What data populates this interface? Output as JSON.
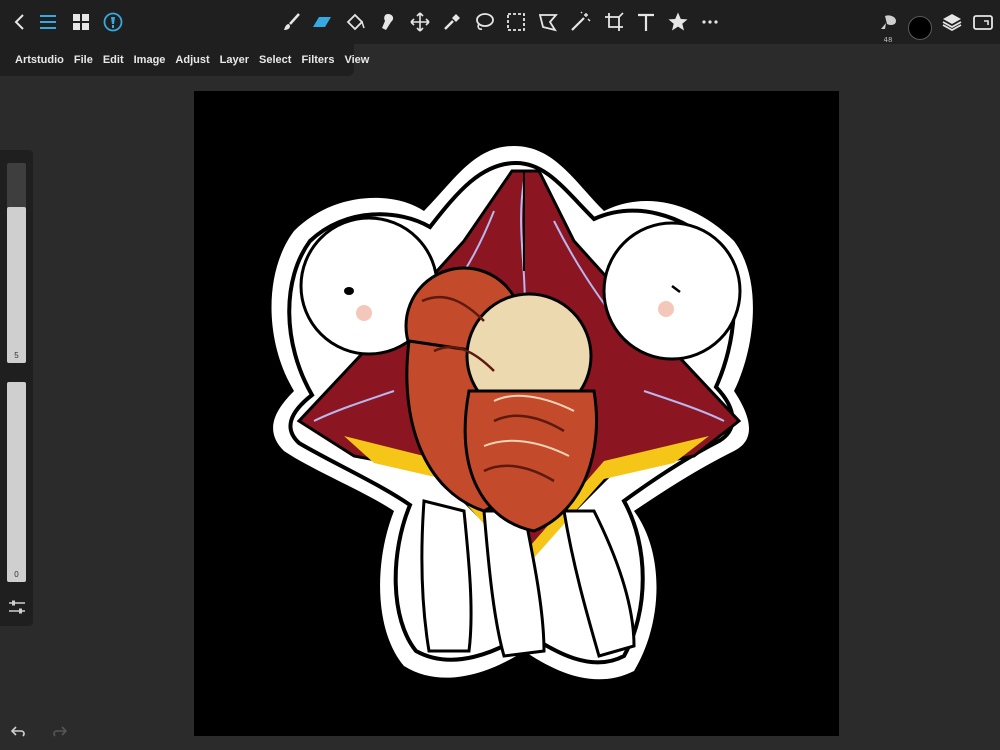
{
  "toolbar": {
    "left": [
      "back-icon",
      "menu-icon",
      "grid-icon",
      "brush-info-icon"
    ],
    "tools": [
      "brush-tool",
      "eraser-tool",
      "fill-tool",
      "smudge-tool",
      "move-tool",
      "eyedropper-tool",
      "lasso-tool",
      "rect-select-tool",
      "poly-select-tool",
      "magic-wand-tool",
      "crop-tool",
      "text-tool",
      "favorites-tool",
      "more-tool"
    ],
    "active_tool": "eraser-tool",
    "brush_size": "48",
    "current_color": "#000000"
  },
  "menu": {
    "items": [
      "Artstudio",
      "File",
      "Edit",
      "Image",
      "Adjust",
      "Layer",
      "Select",
      "Filters",
      "View"
    ]
  },
  "sliders": {
    "size_value": "5",
    "size_fraction": 0.78,
    "opacity_value": "0",
    "opacity_fraction": 1.0
  },
  "colors": {
    "accent": "#36a9e1",
    "panel": "#1f1f1f",
    "background": "#2b2b2b",
    "canvas": "#000000"
  }
}
